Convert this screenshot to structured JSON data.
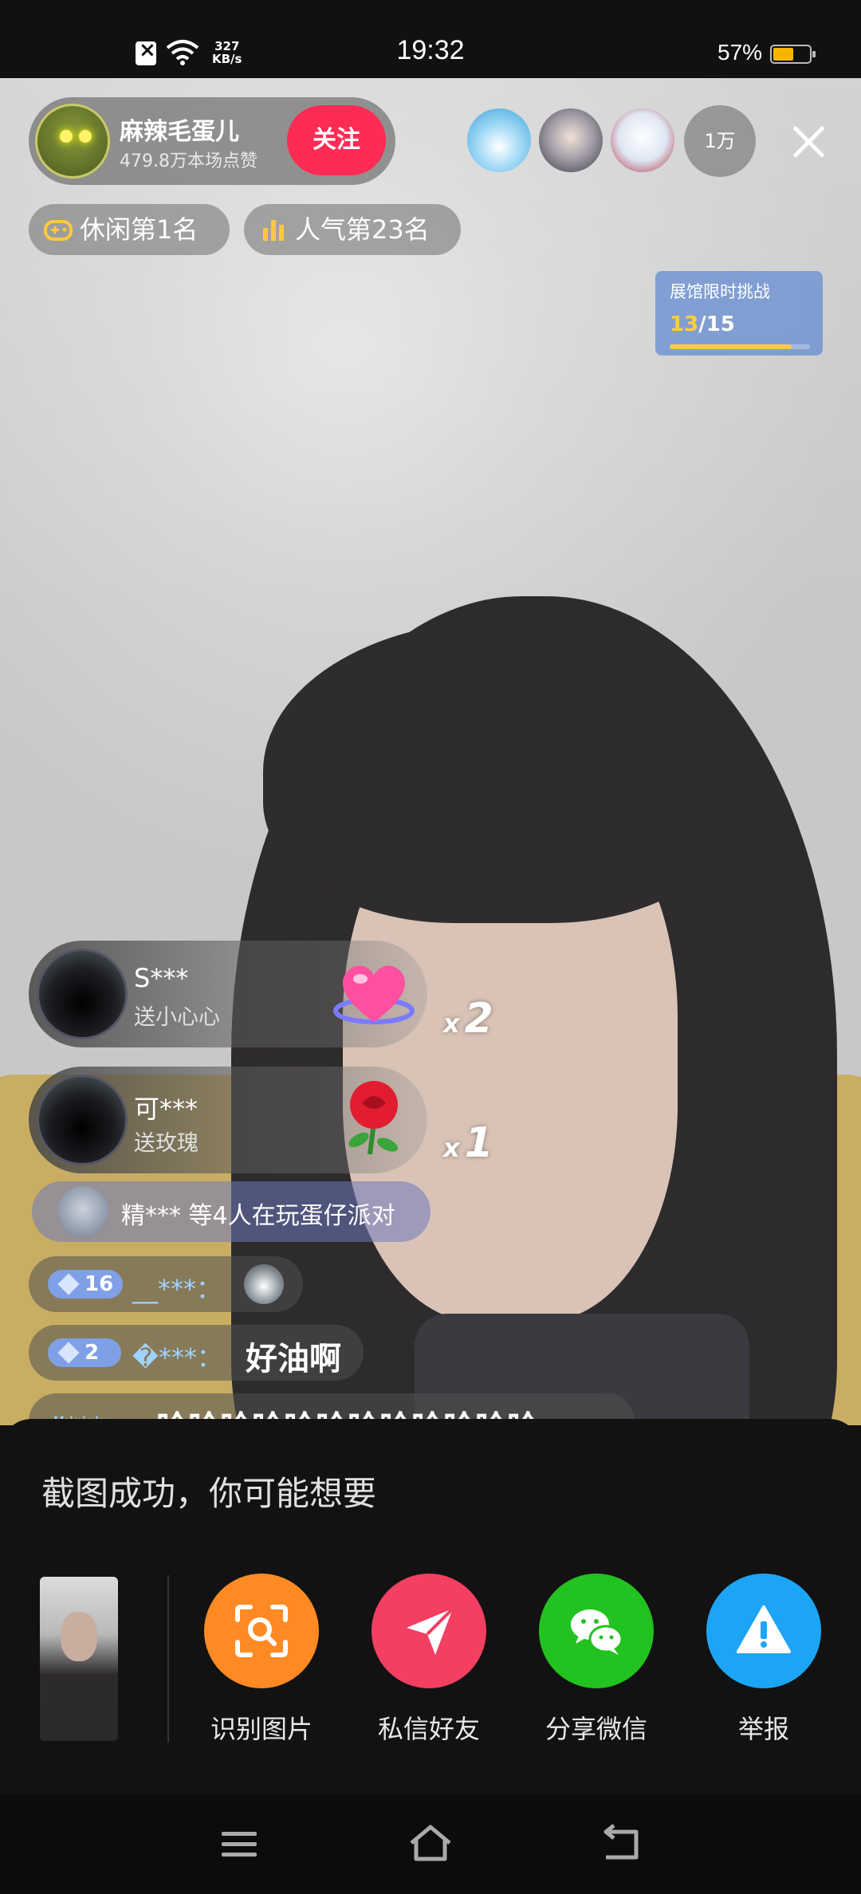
{
  "status_bar": {
    "time": "19:32",
    "net_speed_value": "327",
    "net_speed_unit": "KB/s",
    "battery_percent": "57%",
    "battery_level": 0.57
  },
  "streamer": {
    "name": "麻辣毛蛋儿",
    "likes": "479.8万本场点赞",
    "follow_label": "关注"
  },
  "viewer_count": "1万",
  "ranks": [
    {
      "label": "休闲第1名",
      "icon": "gamepad-icon"
    },
    {
      "label": "人气第23名",
      "icon": "bar-chart-icon"
    }
  ],
  "challenge": {
    "title": "展馆限时挑战",
    "current": "13",
    "sep": "/",
    "total": "15",
    "progress": 0.87
  },
  "gifts": [
    {
      "user": "S***",
      "action": "送小心心",
      "combo_x": "x",
      "combo_n": "2",
      "item": "heart-gift-icon"
    },
    {
      "user": "可***",
      "action": "送玫瑰",
      "combo_x": "x",
      "combo_n": "1",
      "item": "rose-gift-icon"
    }
  ],
  "party_banner": "精*** 等4人在玩蛋仔派对",
  "chat": [
    {
      "level": "16",
      "user": "__***：",
      "message": ""
    },
    {
      "level": "2",
      "user": "�***：",
      "message": "好油啊"
    },
    {
      "level": "",
      "user": "‼***：",
      "message": "哈哈哈哈哈哈哈哈哈哈哈哈"
    }
  ],
  "sheet": {
    "title": "截图成功，你可能想要",
    "actions": [
      {
        "label": "识别图片",
        "icon": "scan-image-icon",
        "color": "#ff8a24"
      },
      {
        "label": "私信好友",
        "icon": "send-message-icon",
        "color": "#f23f62"
      },
      {
        "label": "分享微信",
        "icon": "wechat-icon",
        "color": "#22c220"
      },
      {
        "label": "举报",
        "icon": "report-warning-icon",
        "color": "#1da5f5"
      }
    ]
  }
}
